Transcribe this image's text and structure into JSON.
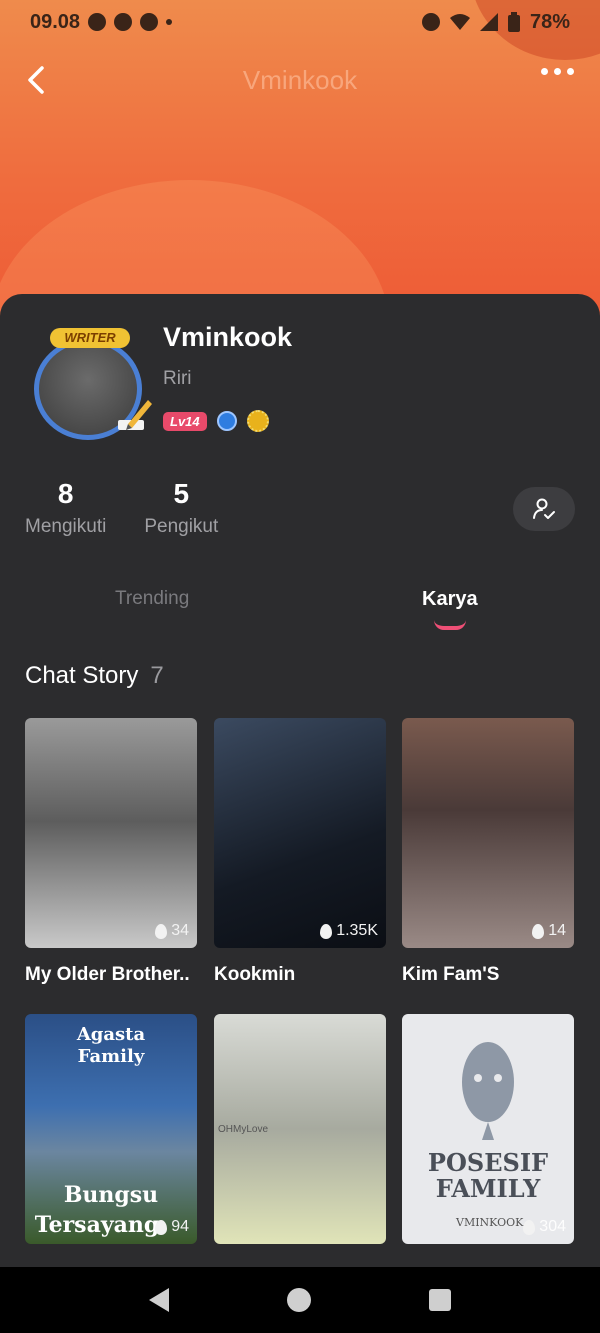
{
  "status": {
    "time": "09.08",
    "battery": "78%"
  },
  "nav": {
    "title": "Vminkook"
  },
  "profile": {
    "badge_label": "WRITER",
    "name": "Vminkook",
    "subname": "Riri",
    "level": "Lv14"
  },
  "stats": [
    {
      "num": "8",
      "label": "Mengikuti"
    },
    {
      "num": "5",
      "label": "Pengikut"
    }
  ],
  "tabs": [
    {
      "label": "Trending",
      "active": false
    },
    {
      "label": "Karya",
      "active": true
    }
  ],
  "section": {
    "title": "Chat Story",
    "count": "7"
  },
  "stories": [
    {
      "title": "My Older Brother..",
      "views": "34",
      "cover": "#8a8a8a"
    },
    {
      "title": "Kookmin",
      "views": "1.35K",
      "cover": "#1a2230"
    },
    {
      "title": "Kim Fam'S",
      "views": "14",
      "cover": "#6a5a52"
    },
    {
      "cover_line1": "Agasta",
      "cover_line2": "Family",
      "cover_line3": "Bungsu",
      "cover_line4": "Tersayang",
      "views": "94",
      "cover": "#274a7a"
    },
    {
      "cover_text": "OHMyLove",
      "views": "",
      "cover": "#c8ccc4"
    },
    {
      "cover_line1": "POSESIF",
      "cover_line2": "FAMILY",
      "cover_author": "VMINKOOK",
      "views": "304",
      "cover": "#e8e9ec"
    }
  ],
  "colors": {
    "accent": "#ef4f76",
    "header_top": "#ef8b4c",
    "header_bottom": "#ee5a35",
    "card_bg": "#2c2c2e"
  }
}
